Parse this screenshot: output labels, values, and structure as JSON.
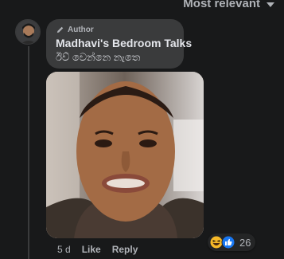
{
  "header": {
    "sort_label": "Most relevant",
    "sort_icon": "chevron-down-icon"
  },
  "comment": {
    "badge_icon": "pencil-icon",
    "badge_label": "Author",
    "author_name": "Madhavi's Bedroom Talks",
    "text": "ඊව් වෙන්නෙ නැතෙ",
    "time": "5 d",
    "like_label": "Like",
    "reply_label": "Reply",
    "reaction_icons": [
      "haha-icon",
      "like-icon"
    ],
    "reaction_count": "26"
  },
  "colors": {
    "background": "#18191a",
    "bubble": "#3a3b3c",
    "primary_text": "#e4e6eb",
    "secondary_text": "#b0b3b8",
    "like_blue": "#1877f2"
  }
}
